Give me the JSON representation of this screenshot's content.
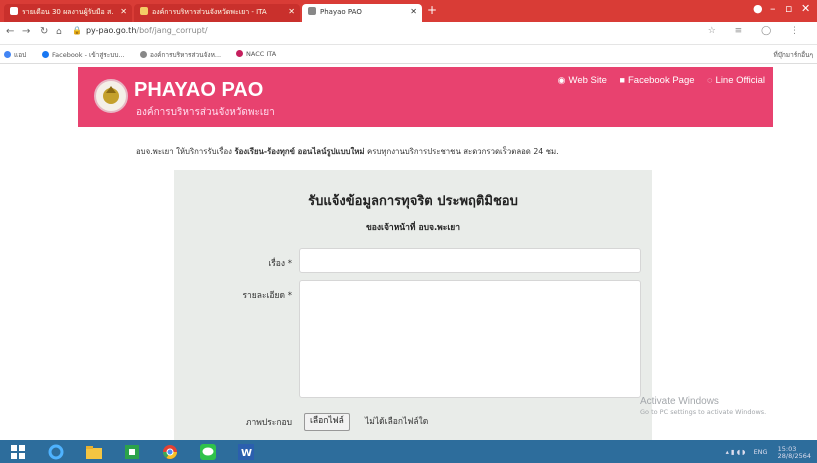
{
  "browser": {
    "tabs": [
      {
        "title": "รายเดือน 30 ผลงานผู้รับมือ ส.",
        "favicon_color": "#ffffff"
      },
      {
        "title": "องค์การบริหารส่วนจังหวัดพะเยา - ITA",
        "favicon_color": "#f4cc66"
      },
      {
        "title": "Phayao PAO",
        "favicon_color": "#888888"
      }
    ],
    "new_tab": "+",
    "url": {
      "host": "py-pao.go.th",
      "path": "/bof/jang_corrupt/"
    },
    "bookmarks": [
      {
        "label": "แอป",
        "color": "#4285f4"
      },
      {
        "label": "Facebook - เข้าสู่ระบบ...",
        "color": "#1877f2"
      },
      {
        "label": "องค์การบริหารส่วนจังห...",
        "color": "#888888"
      },
      {
        "label": "NACC ITA",
        "color": "#c51f5d"
      }
    ],
    "bookmarks_other": "ที่บุ๊กมาร์กอื่นๆ"
  },
  "site": {
    "brand": "PHAYAO PAO",
    "brand_sub": "องค์การบริหารส่วนจังหวัดพะเยา",
    "nav": [
      {
        "label": "Web Site",
        "icon": "globe-icon",
        "glyph": "◉"
      },
      {
        "label": "Facebook Page",
        "icon": "facebook-icon",
        "glyph": "■"
      },
      {
        "label": "Line Official",
        "icon": "line-chat-icon",
        "glyph": "◌"
      }
    ],
    "accent": "#e8426f"
  },
  "announcement": {
    "lead": "อบจ.พะเยา ให้บริการรับเรื่อง ",
    "bold": "ร้องเรียน-ร้องทุกข์ ออนไลน์รูปแบบใหม่",
    "tail": " ครบทุกงานบริการประชาชน สะดวกรวดเร็วตลอด 24 ชม."
  },
  "form": {
    "title": "รับแจ้งข้อมูลการทุจริต ประพฤติมิชอบ",
    "subtitle": "ของเจ้าหน้าที่ อบจ.พะเยา",
    "subject_label": "เรื่อง *",
    "detail_label": "รายละเอียด *",
    "attach_label": "ภาพประกอบ",
    "file_button": "เลือกไฟล์",
    "file_status": "ไม่ได้เลือกไฟล์ใด"
  },
  "watermark": {
    "line1": "Activate Windows",
    "line2": "Go to PC settings to activate Windows."
  },
  "taskbar": {
    "lang": "ENG",
    "time": "15:03",
    "date": "28/8/2564"
  }
}
